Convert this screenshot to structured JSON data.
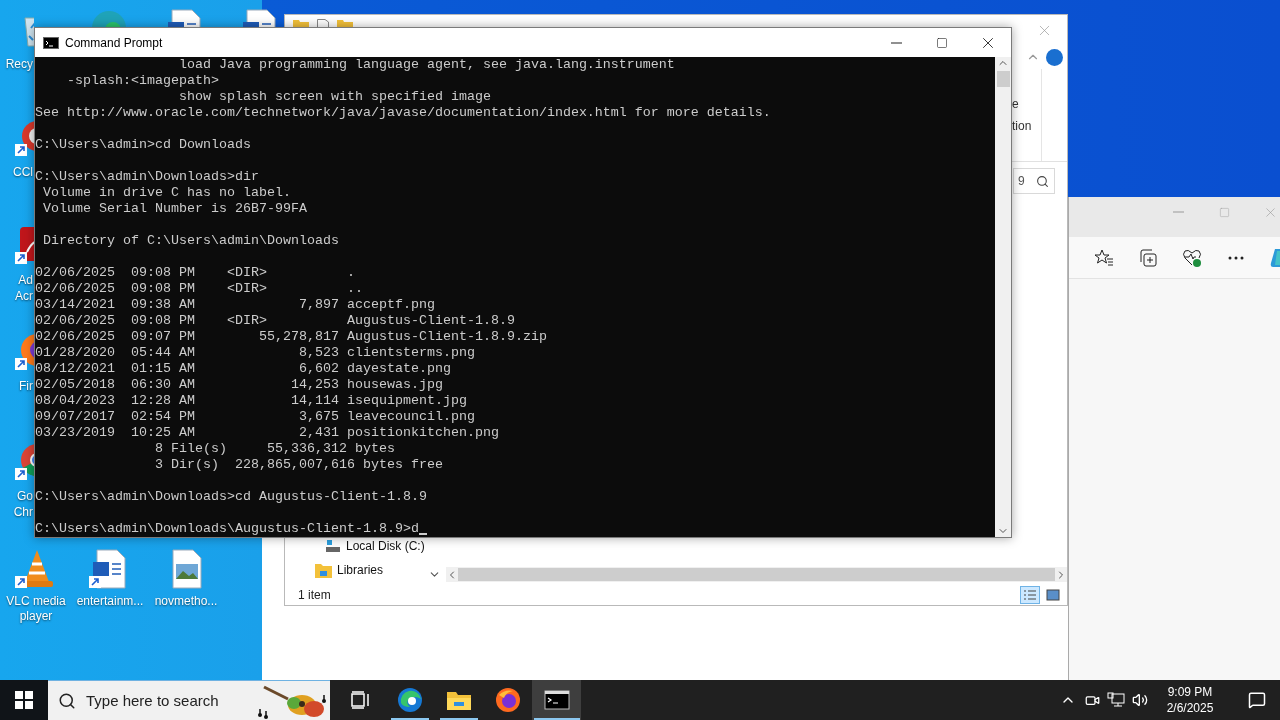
{
  "desktop": {
    "left_column": [
      {
        "kind": "recycle",
        "label": "Recy"
      },
      {
        "kind": "ccleaner",
        "label": "CCl"
      },
      {
        "kind": "acrobat",
        "label": "Ad\nAcr"
      },
      {
        "kind": "firefox",
        "label": "Fir"
      },
      {
        "kind": "chrome",
        "label": "Go\nChr"
      }
    ],
    "top_row": [
      {
        "kind": "edge"
      },
      {
        "kind": "word"
      },
      {
        "kind": "word"
      }
    ],
    "bottom_row": [
      {
        "kind": "vlc",
        "label": "VLC media\nplayer"
      },
      {
        "kind": "word",
        "label": "entertainm..."
      },
      {
        "kind": "image",
        "label": "novmetho..."
      }
    ]
  },
  "explorer": {
    "ribbon_fragments": [
      "e",
      "tion"
    ],
    "search_value": "9",
    "nav_items": [
      {
        "kind": "drive",
        "label": "Local Disk (C:)"
      },
      {
        "kind": "library",
        "label": "Libraries"
      }
    ],
    "status": "1 item",
    "views": [
      {
        "kind": "details",
        "selected": true
      },
      {
        "kind": "large",
        "selected": false
      }
    ]
  },
  "command_prompt": {
    "title": "Command Prompt",
    "cursor": true,
    "blocks": [
      [
        "                  load Java programming language agent, see java.lang.instrument",
        "    -splash:<imagepath>",
        "                  show splash screen with specified image",
        "See http://www.oracle.com/technetwork/java/javase/documentation/index.html for more details."
      ],
      [
        "C:\\Users\\admin>cd Downloads"
      ],
      [
        "C:\\Users\\admin\\Downloads>dir",
        " Volume in drive C has no label.",
        " Volume Serial Number is 26B7-99FA"
      ],
      [
        " Directory of C:\\Users\\admin\\Downloads"
      ],
      [
        "02/06/2025  09:08 PM    <DIR>          .",
        "02/06/2025  09:08 PM    <DIR>          ..",
        "03/14/2021  09:38 AM             7,897 acceptf.png",
        "02/06/2025  09:08 PM    <DIR>          Augustus-Client-1.8.9",
        "02/06/2025  09:07 PM        55,278,817 Augustus-Client-1.8.9.zip",
        "01/28/2020  05:44 AM             8,523 clientsterms.png",
        "08/12/2021  01:15 AM             6,602 dayestate.png",
        "02/05/2018  06:30 AM            14,253 housewas.jpg",
        "08/04/2023  12:28 AM            14,114 isequipment.jpg",
        "09/07/2017  02:54 PM             3,675 leavecouncil.png",
        "03/23/2019  10:25 AM             2,431 positionkitchen.png",
        "               8 File(s)     55,336,312 bytes",
        "               3 Dir(s)  228,865,007,616 bytes free"
      ],
      [
        "C:\\Users\\admin\\Downloads>cd Augustus-Client-1.8.9"
      ],
      [
        "C:\\Users\\admin\\Downloads\\Augustus-Client-1.8.9>d"
      ]
    ]
  },
  "taskbar": {
    "search_placeholder": "Type here to search",
    "apps": [
      {
        "kind": "taskview",
        "running": false,
        "selected": false
      },
      {
        "kind": "edge",
        "running": true,
        "selected": false
      },
      {
        "kind": "explorer",
        "running": true,
        "selected": false
      },
      {
        "kind": "firefox",
        "running": false,
        "selected": false
      },
      {
        "kind": "cmd",
        "running": true,
        "selected": true
      }
    ],
    "clock": {
      "time": "9:09 PM",
      "date": "2/6/2025"
    }
  }
}
